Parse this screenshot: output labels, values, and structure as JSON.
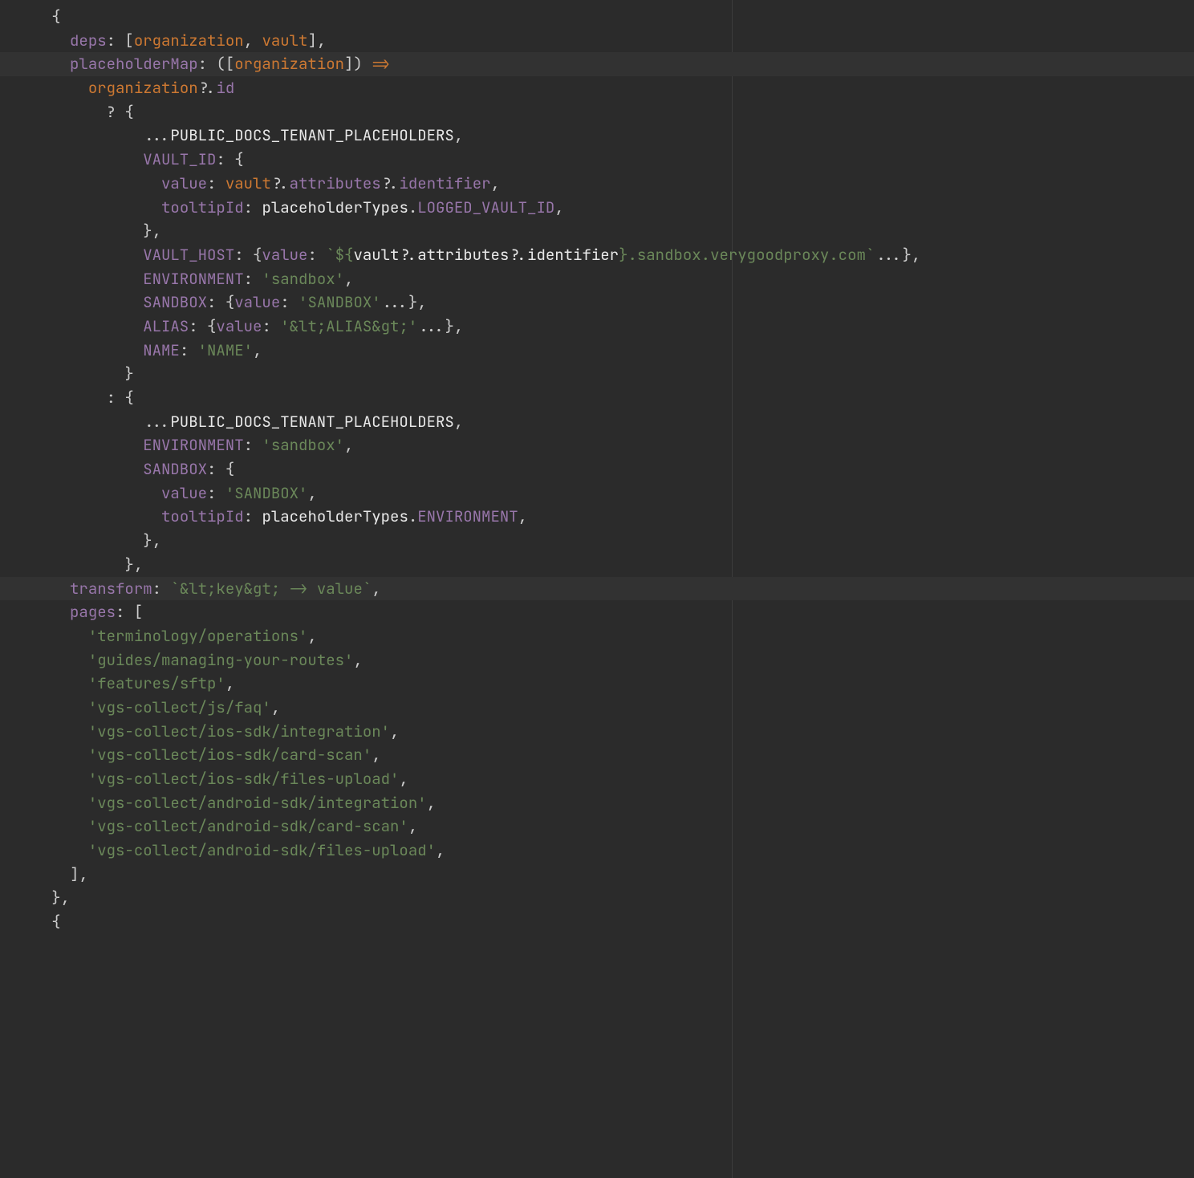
{
  "tokens": {
    "deps": "deps",
    "organization": "organization",
    "vault": "vault",
    "placeholderMap": "placeholderMap",
    "id": "id",
    "PUBLIC_DOCS_TENANT_PLACEHOLDERS": "PUBLIC_DOCS_TENANT_PLACEHOLDERS",
    "VAULT_ID": "VAULT_ID",
    "value": "value",
    "attributes": "attributes",
    "identifier": "identifier",
    "tooltipId": "tooltipId",
    "placeholderTypes": "placeholderTypes",
    "LOGGED_VAULT_ID": "LOGGED_VAULT_ID",
    "VAULT_HOST": "VAULT_HOST",
    "vault_host_tmpl_pre": "`${",
    "vault_host_tmpl_mid": "vault?.attributes?.identifier",
    "vault_host_tmpl_post": "}.sandbox.verygoodproxy.com`",
    "ENVIRONMENT": "ENVIRONMENT",
    "sandbox_str": "'sandbox'",
    "SANDBOX": "SANDBOX",
    "sandbox_val": "'SANDBOX'",
    "ALIAS": "ALIAS",
    "alias_val": "'&lt;ALIAS&gt;'",
    "NAME": "NAME",
    "name_val": "'NAME'",
    "transform": "transform",
    "transform_val": "`&lt;key&gt; -> value`",
    "pages": "pages"
  },
  "pages": [
    "'terminology/operations'",
    "'guides/managing-your-routes'",
    "'features/sftp'",
    "'vgs-collect/js/faq'",
    "'vgs-collect/ios-sdk/integration'",
    "'vgs-collect/ios-sdk/card-scan'",
    "'vgs-collect/ios-sdk/files-upload'",
    "'vgs-collect/android-sdk/integration'",
    "'vgs-collect/android-sdk/card-scan'",
    "'vgs-collect/android-sdk/files-upload'"
  ]
}
